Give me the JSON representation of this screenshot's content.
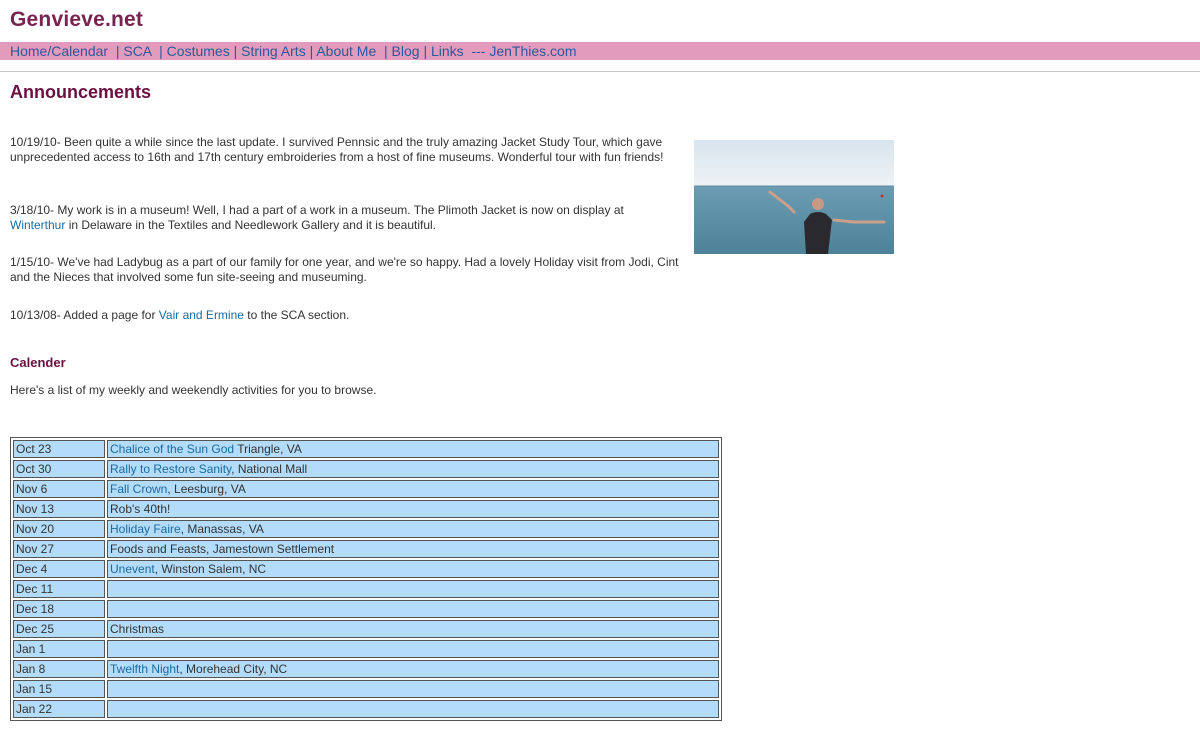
{
  "site": {
    "title": "Genvieve.net"
  },
  "nav": {
    "text": "Home/Calendar  | SCA  | Costumes | String Arts | About Me  | Blog | Links  --- JenThies.com"
  },
  "main": {
    "heading": "Announcements",
    "announcements": [
      {
        "pre": "10/19/10- Been quite a while since the last update. I survived Pennsic and the truly amazing Jacket Study Tour, which gave unprecedented access to 16th and 17th century embroideries from a host of fine museums. Wonderful tour with fun friends!",
        "link": "",
        "post": ""
      },
      {
        "pre": "3/18/10- My work is in a museum! Well, I had a part of a work in a museum. The Plimoth Jacket is now on display at ",
        "link": "Winterthur",
        "post": " in Delaware in the Textiles and Needlework Gallery and it is beautiful."
      },
      {
        "pre": "1/15/10- We've had Ladybug as a part of our family for one year, and we're so happy. Had a lovely Holiday visit from Jodi, Cint and the Nieces that involved some fun site-seeing and museuming.",
        "link": "",
        "post": ""
      },
      {
        "pre": "10/13/08- Added a page for ",
        "link": "Vair and Ermine",
        "post": " to the SCA section."
      }
    ]
  },
  "calendar": {
    "heading": "Calender",
    "intro": "Here's a list of my weekly and weekendly activities for you to browse.",
    "rows": [
      {
        "date": "Oct 23",
        "link": "Chalice of the Sun God",
        "rest": " Triangle, VA"
      },
      {
        "date": "Oct 30",
        "link": "Rally to Restore Sanity",
        "rest": ", National Mall"
      },
      {
        "date": "Nov 6",
        "link": "Fall Crown",
        "rest": ", Leesburg, VA"
      },
      {
        "date": "Nov 13",
        "link": "",
        "rest": "Rob's 40th!"
      },
      {
        "date": "Nov 20",
        "link": "Holiday Faire",
        "rest": ", Manassas, VA"
      },
      {
        "date": "Nov 27",
        "link": "",
        "rest": "Foods and Feasts, Jamestown Settlement"
      },
      {
        "date": "Dec 4",
        "link": "Unevent",
        "rest": ", Winston Salem, NC"
      },
      {
        "date": "Dec 11",
        "link": "",
        "rest": ""
      },
      {
        "date": "Dec 18",
        "link": "",
        "rest": ""
      },
      {
        "date": "Dec 25",
        "link": "",
        "rest": "Christmas"
      },
      {
        "date": "Jan 1",
        "link": "",
        "rest": ""
      },
      {
        "date": "Jan 8",
        "link": "Twelfth Night",
        "rest": ", Morehead City, NC"
      },
      {
        "date": "Jan 15",
        "link": "",
        "rest": ""
      },
      {
        "date": "Jan 22",
        "link": "",
        "rest": ""
      }
    ]
  }
}
